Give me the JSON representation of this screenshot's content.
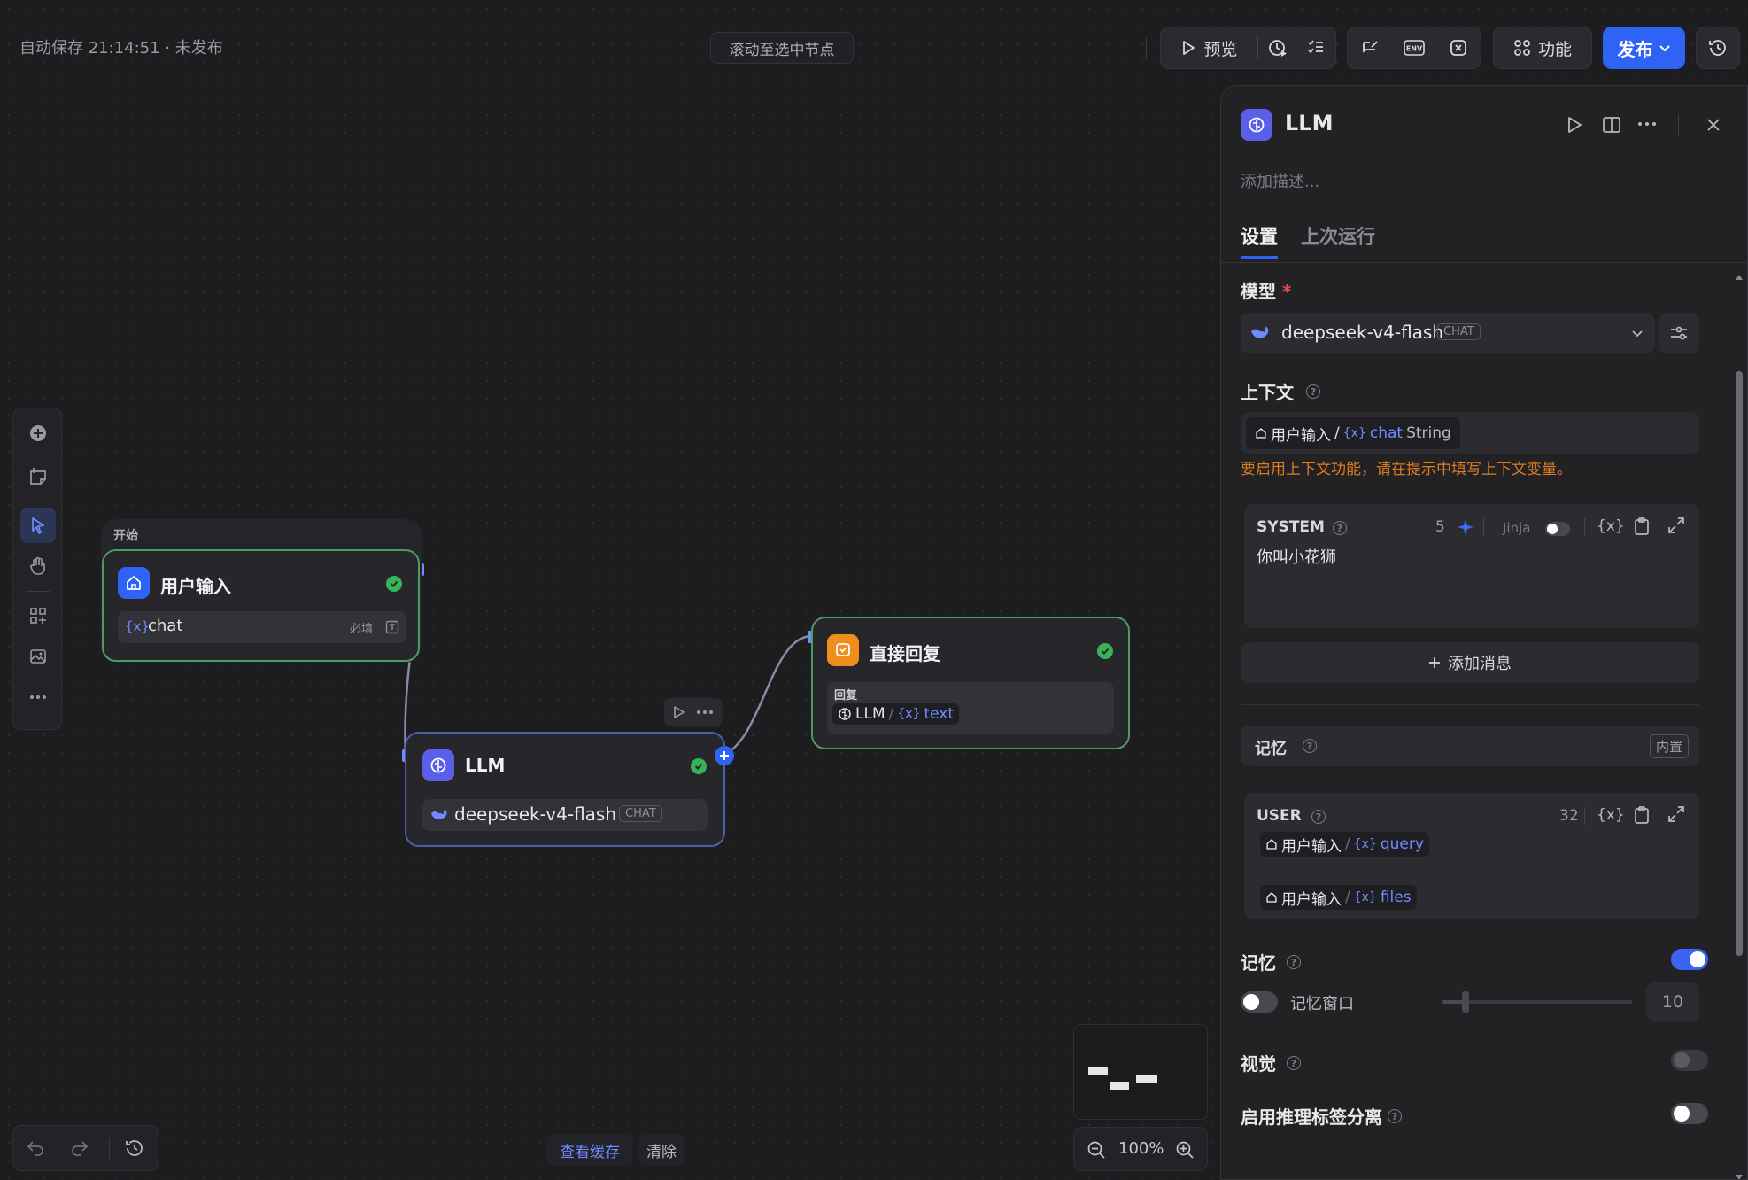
{
  "topbar": {
    "autosave": "自动保存 21:14:51 · 未发布",
    "scroll_to_node": "滚动至选中节点",
    "preview_label": "预览",
    "features_label": "功能",
    "publish_label": "发布"
  },
  "canvas": {
    "start_group_title": "开始",
    "start_node": {
      "title": "用户输入",
      "var_name": "chat",
      "required_label": "必填"
    },
    "llm_node": {
      "title": "LLM",
      "model": "deepseek-v4-flash",
      "model_tag": "CHAT"
    },
    "reply_node": {
      "title": "直接回复",
      "field_label": "回复",
      "ref_node": "LLM",
      "ref_var": "text"
    },
    "view_cache": "查看缓存",
    "clear": "清除",
    "zoom": "100%"
  },
  "panel": {
    "title": "LLM",
    "description_placeholder": "添加描述...",
    "tabs": [
      {
        "label": "设置",
        "active": true
      },
      {
        "label": "上次运行",
        "active": false
      }
    ],
    "model_label": "模型",
    "required_star": "*",
    "model_name": "deepseek-v4-flash",
    "model_tag": "CHAT",
    "context_label": "上下文",
    "context_chip": {
      "node": "用户输入",
      "sep": "/",
      "var": "chat",
      "type": "String"
    },
    "context_warning": "要启用上下文功能，请在提示中填写上下文变量。",
    "system": {
      "label": "SYSTEM",
      "count": "5",
      "jinja": "Jinja",
      "text": "你叫小花狮"
    },
    "add_message": "添加消息",
    "memory_box": {
      "label": "记忆",
      "badge": "内置"
    },
    "user": {
      "label": "USER",
      "count": "32",
      "chips": [
        {
          "node": "用户输入",
          "sep": "/",
          "var": "query"
        },
        {
          "node": "用户输入",
          "sep": "/",
          "var": "files"
        }
      ]
    },
    "memory_label": "记忆",
    "memory_window_label": "记忆窗口",
    "memory_window_value": "10",
    "vision_label": "视觉",
    "reasoning_label": "启用推理标签分离"
  },
  "colors": {
    "accent": "#2f63f5",
    "success": "#37b35a",
    "warning": "#e07b1f",
    "link": "#6f8cff"
  }
}
